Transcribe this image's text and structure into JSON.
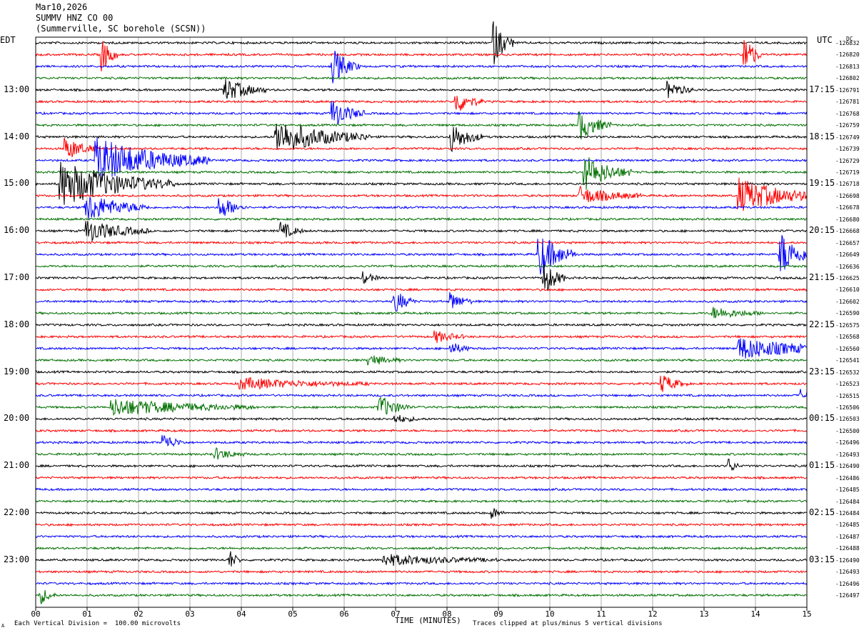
{
  "header": {
    "date": "Mar10,2026",
    "station": "SUMMV HNZ CO 00",
    "location": "(Summerville, SC borehole (SCSN))"
  },
  "left_axis_label": "EDT",
  "right_axis_label": "UTC",
  "dc_label": "DC",
  "footer": {
    "scale_text": "Each Vertical Division =  100.00 microvolts",
    "clip_text": "Traces clipped at plus/minus 5 vertical divisions",
    "corner_mark": "A"
  },
  "trace_colors": [
    "#000000",
    "#ff0000",
    "#0000ff",
    "#007000"
  ],
  "chart_data": {
    "type": "line",
    "xlabel": "TIME (MINUTES)",
    "xlim": [
      0,
      15
    ],
    "x_ticks": [
      "00",
      "01",
      "02",
      "03",
      "04",
      "05",
      "06",
      "07",
      "08",
      "09",
      "10",
      "11",
      "12",
      "13",
      "14",
      "15"
    ],
    "traces_per_hour": 4,
    "left_hour_labels": [
      "13:00",
      "14:00",
      "15:00",
      "16:00",
      "17:00",
      "18:00",
      "19:00",
      "20:00",
      "21:00",
      "22:00",
      "23:00"
    ],
    "right_hour_labels": [
      "17:15",
      "18:15",
      "19:15",
      "20:15",
      "21:15",
      "22:15",
      "23:15",
      "00:15",
      "01:15",
      "02:15",
      "03:15"
    ],
    "dc_offsets": [
      "-126832",
      "-126820",
      "-126813",
      "-126802",
      "-126791",
      "-126781",
      "-126768",
      "-126759",
      "-126749",
      "-126739",
      "-126729",
      "-126719",
      "-126718",
      "-126698",
      "-126678",
      "-126680",
      "-126668",
      "-126657",
      "-126649",
      "-126636",
      "-126625",
      "-126610",
      "-126602",
      "-126590",
      "-126575",
      "-126568",
      "-126560",
      "-126541",
      "-126532",
      "-126523",
      "-126515",
      "-126506",
      "-126503",
      "-126500",
      "-126496",
      "-126493",
      "-126490",
      "-126486",
      "-126485",
      "-126484",
      "-126484",
      "-126485",
      "-126487",
      "-126488",
      "-126490",
      "-126493",
      "-126496",
      "-126497"
    ],
    "events": [
      {
        "trace": 0,
        "minute": 8.9,
        "amp": 8,
        "dur": 0.4
      },
      {
        "trace": 1,
        "minute": 1.3,
        "amp": 6,
        "dur": 0.3
      },
      {
        "trace": 1,
        "minute": 13.8,
        "amp": 8,
        "dur": 0.3
      },
      {
        "trace": 2,
        "minute": 5.8,
        "amp": 6,
        "dur": 0.5
      },
      {
        "trace": 4,
        "minute": 3.7,
        "amp": 4,
        "dur": 0.8
      },
      {
        "trace": 4,
        "minute": 12.3,
        "amp": 3,
        "dur": 0.5
      },
      {
        "trace": 5,
        "minute": 8.2,
        "amp": 4,
        "dur": 0.5
      },
      {
        "trace": 6,
        "minute": 5.8,
        "amp": 5,
        "dur": 0.6
      },
      {
        "trace": 7,
        "minute": 10.6,
        "amp": 5,
        "dur": 0.6
      },
      {
        "trace": 8,
        "minute": 4.7,
        "amp": 6,
        "dur": 1.8
      },
      {
        "trace": 8,
        "minute": 8.1,
        "amp": 5,
        "dur": 0.6
      },
      {
        "trace": 9,
        "minute": 0.6,
        "amp": 4,
        "dur": 0.6
      },
      {
        "trace": 10,
        "minute": 1.2,
        "amp": 8,
        "dur": 2.2
      },
      {
        "trace": 11,
        "minute": 10.7,
        "amp": 6,
        "dur": 0.9
      },
      {
        "trace": 12,
        "minute": 0.5,
        "amp": 8,
        "dur": 2.2
      },
      {
        "trace": 13,
        "minute": 13.7,
        "amp": 6,
        "dur": 1.6
      },
      {
        "trace": 13,
        "minute": 10.6,
        "amp": 3,
        "dur": 1.2
      },
      {
        "trace": 14,
        "minute": 1.0,
        "amp": 5,
        "dur": 1.2
      },
      {
        "trace": 14,
        "minute": 3.6,
        "amp": 4,
        "dur": 0.5
      },
      {
        "trace": 16,
        "minute": 1.0,
        "amp": 4,
        "dur": 1.2
      },
      {
        "trace": 16,
        "minute": 4.8,
        "amp": 3,
        "dur": 0.4
      },
      {
        "trace": 18,
        "minute": 9.8,
        "amp": 8,
        "dur": 0.7
      },
      {
        "trace": 18,
        "minute": 14.5,
        "amp": 8,
        "dur": 0.6
      },
      {
        "trace": 20,
        "minute": 9.9,
        "amp": 6,
        "dur": 0.4
      },
      {
        "trace": 20,
        "minute": 6.4,
        "amp": 2,
        "dur": 0.3
      },
      {
        "trace": 22,
        "minute": 7.0,
        "amp": 4,
        "dur": 0.4
      },
      {
        "trace": 22,
        "minute": 8.1,
        "amp": 3,
        "dur": 0.4
      },
      {
        "trace": 23,
        "minute": 13.2,
        "amp": 2,
        "dur": 1.0
      },
      {
        "trace": 25,
        "minute": 7.8,
        "amp": 2,
        "dur": 0.6
      },
      {
        "trace": 26,
        "minute": 13.7,
        "amp": 4,
        "dur": 2.0
      },
      {
        "trace": 26,
        "minute": 8.1,
        "amp": 2,
        "dur": 0.4
      },
      {
        "trace": 27,
        "minute": 6.5,
        "amp": 2,
        "dur": 0.6
      },
      {
        "trace": 29,
        "minute": 4.0,
        "amp": 2,
        "dur": 2.5
      },
      {
        "trace": 29,
        "minute": 12.2,
        "amp": 3,
        "dur": 0.5
      },
      {
        "trace": 30,
        "minute": 14.9,
        "amp": 2,
        "dur": 0.6
      },
      {
        "trace": 31,
        "minute": 1.5,
        "amp": 3,
        "dur": 2.8
      },
      {
        "trace": 31,
        "minute": 6.7,
        "amp": 4,
        "dur": 0.6
      },
      {
        "trace": 32,
        "minute": 7.0,
        "amp": 1.5,
        "dur": 0.5
      },
      {
        "trace": 34,
        "minute": 2.5,
        "amp": 3,
        "dur": 0.4
      },
      {
        "trace": 35,
        "minute": 3.5,
        "amp": 2,
        "dur": 0.6
      },
      {
        "trace": 36,
        "minute": 13.5,
        "amp": 2.5,
        "dur": 0.2
      },
      {
        "trace": 40,
        "minute": 8.9,
        "amp": 2,
        "dur": 0.2
      },
      {
        "trace": 44,
        "minute": 6.8,
        "amp": 2,
        "dur": 2.2
      },
      {
        "trace": 44,
        "minute": 3.8,
        "amp": 3,
        "dur": 0.2
      },
      {
        "trace": 47,
        "minute": 0.1,
        "amp": 3,
        "dur": 0.3
      }
    ]
  }
}
